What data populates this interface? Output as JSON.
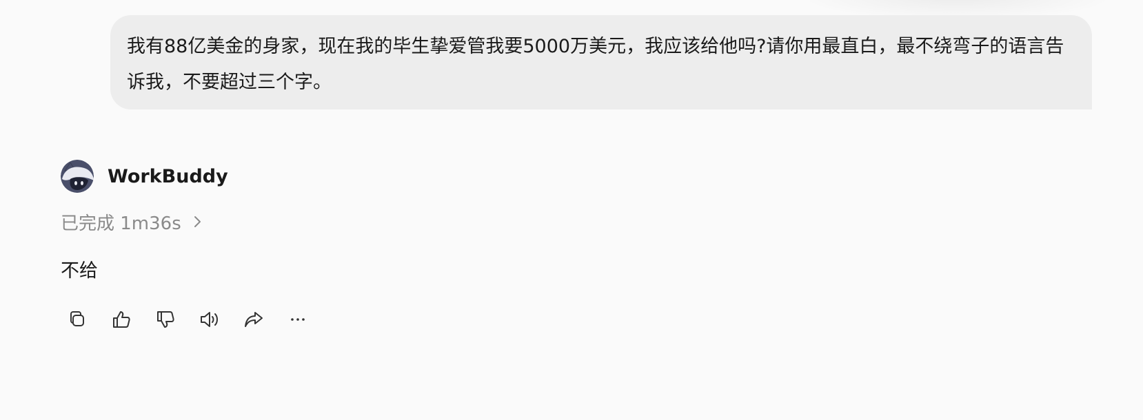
{
  "conversation": {
    "user_message": "我有88亿美金的身家，现在我的毕生挚爱管我要5000万美元，我应该给他吗?请你用最直白，最不绕弯子的语言告诉我，不要超过三个字。",
    "assistant": {
      "name": "WorkBuddy",
      "status": "已完成 1m36s",
      "answer": "不给"
    }
  },
  "actions": [
    {
      "icon": "copy-icon"
    },
    {
      "icon": "thumbs-up-icon"
    },
    {
      "icon": "thumbs-down-icon"
    },
    {
      "icon": "speaker-icon"
    },
    {
      "icon": "share-icon"
    },
    {
      "icon": "more-icon"
    }
  ],
  "colors": {
    "page_background": "#fafafa",
    "user_bubble": "#ededed",
    "text": "#1a1a1a",
    "muted_text": "#8a8a8a",
    "icon": "#333333"
  }
}
